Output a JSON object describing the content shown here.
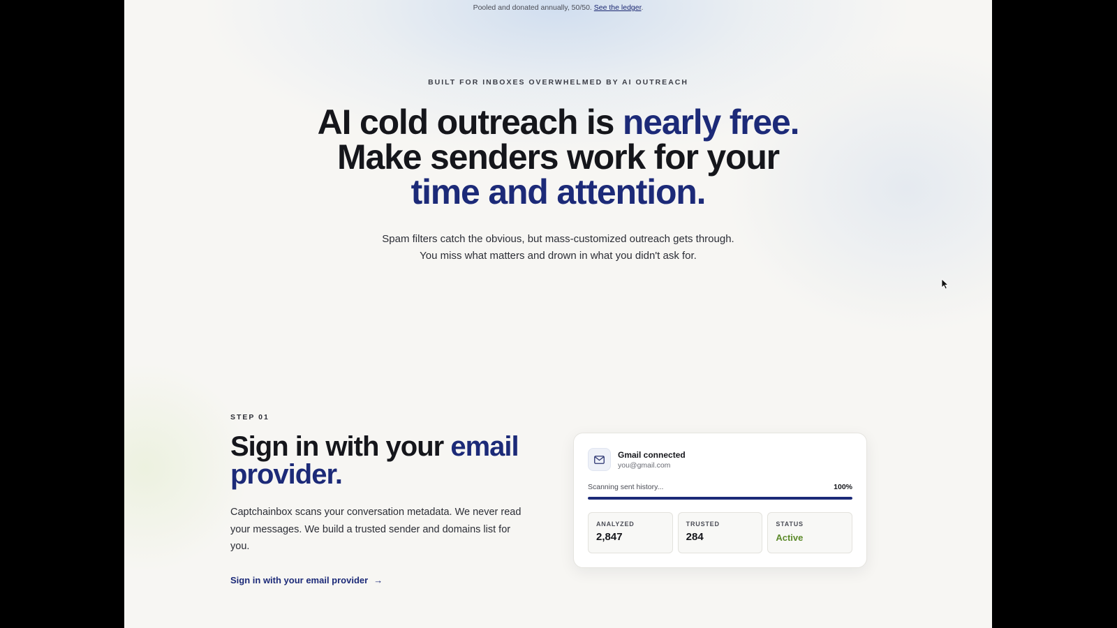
{
  "top_note": {
    "text": "Pooled and donated annually, 50/50.",
    "link": "See the ledger",
    "suffix": "."
  },
  "hero": {
    "eyebrow": "BUILT FOR INBOXES OVERWHELMED BY AI OUTREACH",
    "headline_part1": "AI cold outreach is ",
    "headline_highlight1": "nearly free.",
    "headline_part2": "Make senders work for your",
    "headline_highlight2": "time and attention.",
    "sub_line1": "Spam filters catch the obvious, but mass-customized outreach gets through.",
    "sub_line2": "You miss what matters and drown in what you didn't ask for."
  },
  "step1": {
    "label": "STEP 01",
    "title_part1": "Sign in with your ",
    "title_highlight": "email provider.",
    "description": "Captchainbox scans your conversation metadata. We never read your messages. We build a trusted sender and domains list for you.",
    "link_label": "Sign in with your email provider",
    "link_arrow": "→"
  },
  "card": {
    "icon": "mail-icon",
    "title": "Gmail connected",
    "email": "you@gmail.com",
    "scan_label": "Scanning sent history...",
    "scan_percent_label": "100%",
    "scan_progress": 1.0,
    "stats": [
      {
        "label": "ANALYZED",
        "value": "2,847"
      },
      {
        "label": "TRUSTED",
        "value": "284"
      },
      {
        "label": "STATUS",
        "value": "Active"
      }
    ]
  },
  "colors": {
    "accent": "#1c2a78",
    "status_active": "#5c8a2a",
    "background": "#f7f6f3"
  }
}
